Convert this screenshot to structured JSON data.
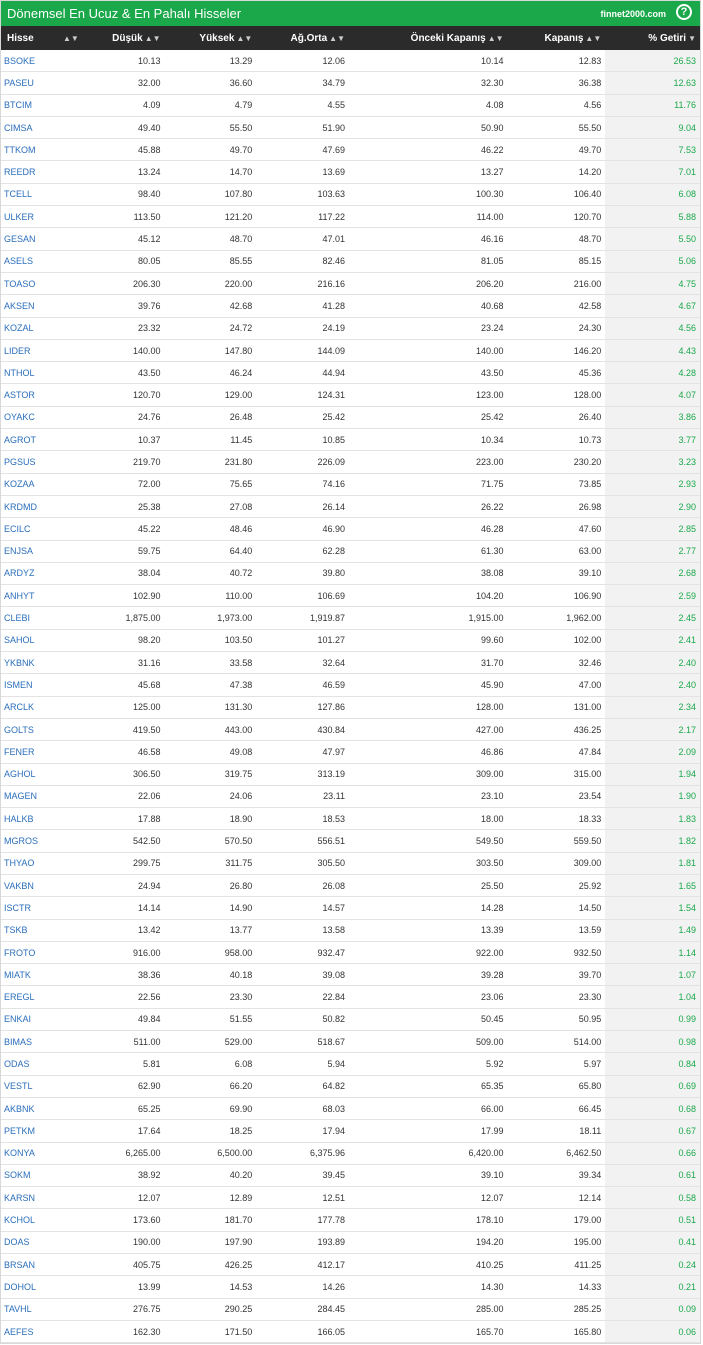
{
  "header": {
    "title": "Dönemsel En Ucuz & En Pahalı Hisseler",
    "brand": "finnet2000.com",
    "help": "?"
  },
  "columns": [
    "Hisse",
    "Düşük",
    "Yüksek",
    "Ağ.Orta",
    "Önceki Kapanış",
    "Kapanış",
    "% Getiri"
  ],
  "accent_color": "#1aa84a",
  "rows": [
    [
      "BSOKE",
      "10.13",
      "13.29",
      "12.06",
      "10.14",
      "12.83",
      "26.53"
    ],
    [
      "PASEU",
      "32.00",
      "36.60",
      "34.79",
      "32.30",
      "36.38",
      "12.63"
    ],
    [
      "BTCIM",
      "4.09",
      "4.79",
      "4.55",
      "4.08",
      "4.56",
      "11.76"
    ],
    [
      "CIMSA",
      "49.40",
      "55.50",
      "51.90",
      "50.90",
      "55.50",
      "9.04"
    ],
    [
      "TTKOM",
      "45.88",
      "49.70",
      "47.69",
      "46.22",
      "49.70",
      "7.53"
    ],
    [
      "REEDR",
      "13.24",
      "14.70",
      "13.69",
      "13.27",
      "14.20",
      "7.01"
    ],
    [
      "TCELL",
      "98.40",
      "107.80",
      "103.63",
      "100.30",
      "106.40",
      "6.08"
    ],
    [
      "ULKER",
      "113.50",
      "121.20",
      "117.22",
      "114.00",
      "120.70",
      "5.88"
    ],
    [
      "GESAN",
      "45.12",
      "48.70",
      "47.01",
      "46.16",
      "48.70",
      "5.50"
    ],
    [
      "ASELS",
      "80.05",
      "85.55",
      "82.46",
      "81.05",
      "85.15",
      "5.06"
    ],
    [
      "TOASO",
      "206.30",
      "220.00",
      "216.16",
      "206.20",
      "216.00",
      "4.75"
    ],
    [
      "AKSEN",
      "39.76",
      "42.68",
      "41.28",
      "40.68",
      "42.58",
      "4.67"
    ],
    [
      "KOZAL",
      "23.32",
      "24.72",
      "24.19",
      "23.24",
      "24.30",
      "4.56"
    ],
    [
      "LIDER",
      "140.00",
      "147.80",
      "144.09",
      "140.00",
      "146.20",
      "4.43"
    ],
    [
      "NTHOL",
      "43.50",
      "46.24",
      "44.94",
      "43.50",
      "45.36",
      "4.28"
    ],
    [
      "ASTOR",
      "120.70",
      "129.00",
      "124.31",
      "123.00",
      "128.00",
      "4.07"
    ],
    [
      "OYAKC",
      "24.76",
      "26.48",
      "25.42",
      "25.42",
      "26.40",
      "3.86"
    ],
    [
      "AGROT",
      "10.37",
      "11.45",
      "10.85",
      "10.34",
      "10.73",
      "3.77"
    ],
    [
      "PGSUS",
      "219.70",
      "231.80",
      "226.09",
      "223.00",
      "230.20",
      "3.23"
    ],
    [
      "KOZAA",
      "72.00",
      "75.65",
      "74.16",
      "71.75",
      "73.85",
      "2.93"
    ],
    [
      "KRDMD",
      "25.38",
      "27.08",
      "26.14",
      "26.22",
      "26.98",
      "2.90"
    ],
    [
      "ECILC",
      "45.22",
      "48.46",
      "46.90",
      "46.28",
      "47.60",
      "2.85"
    ],
    [
      "ENJSA",
      "59.75",
      "64.40",
      "62.28",
      "61.30",
      "63.00",
      "2.77"
    ],
    [
      "ARDYZ",
      "38.04",
      "40.72",
      "39.80",
      "38.08",
      "39.10",
      "2.68"
    ],
    [
      "ANHYT",
      "102.90",
      "110.00",
      "106.69",
      "104.20",
      "106.90",
      "2.59"
    ],
    [
      "CLEBI",
      "1,875.00",
      "1,973.00",
      "1,919.87",
      "1,915.00",
      "1,962.00",
      "2.45"
    ],
    [
      "SAHOL",
      "98.20",
      "103.50",
      "101.27",
      "99.60",
      "102.00",
      "2.41"
    ],
    [
      "YKBNK",
      "31.16",
      "33.58",
      "32.64",
      "31.70",
      "32.46",
      "2.40"
    ],
    [
      "ISMEN",
      "45.68",
      "47.38",
      "46.59",
      "45.90",
      "47.00",
      "2.40"
    ],
    [
      "ARCLK",
      "125.00",
      "131.30",
      "127.86",
      "128.00",
      "131.00",
      "2.34"
    ],
    [
      "GOLTS",
      "419.50",
      "443.00",
      "430.84",
      "427.00",
      "436.25",
      "2.17"
    ],
    [
      "FENER",
      "46.58",
      "49.08",
      "47.97",
      "46.86",
      "47.84",
      "2.09"
    ],
    [
      "AGHOL",
      "306.50",
      "319.75",
      "313.19",
      "309.00",
      "315.00",
      "1.94"
    ],
    [
      "MAGEN",
      "22.06",
      "24.06",
      "23.11",
      "23.10",
      "23.54",
      "1.90"
    ],
    [
      "HALKB",
      "17.88",
      "18.90",
      "18.53",
      "18.00",
      "18.33",
      "1.83"
    ],
    [
      "MGROS",
      "542.50",
      "570.50",
      "556.51",
      "549.50",
      "559.50",
      "1.82"
    ],
    [
      "THYAO",
      "299.75",
      "311.75",
      "305.50",
      "303.50",
      "309.00",
      "1.81"
    ],
    [
      "VAKBN",
      "24.94",
      "26.80",
      "26.08",
      "25.50",
      "25.92",
      "1.65"
    ],
    [
      "ISCTR",
      "14.14",
      "14.90",
      "14.57",
      "14.28",
      "14.50",
      "1.54"
    ],
    [
      "TSKB",
      "13.42",
      "13.77",
      "13.58",
      "13.39",
      "13.59",
      "1.49"
    ],
    [
      "FROTO",
      "916.00",
      "958.00",
      "932.47",
      "922.00",
      "932.50",
      "1.14"
    ],
    [
      "MIATK",
      "38.36",
      "40.18",
      "39.08",
      "39.28",
      "39.70",
      "1.07"
    ],
    [
      "EREGL",
      "22.56",
      "23.30",
      "22.84",
      "23.06",
      "23.30",
      "1.04"
    ],
    [
      "ENKAI",
      "49.84",
      "51.55",
      "50.82",
      "50.45",
      "50.95",
      "0.99"
    ],
    [
      "BIMAS",
      "511.00",
      "529.00",
      "518.67",
      "509.00",
      "514.00",
      "0.98"
    ],
    [
      "ODAS",
      "5.81",
      "6.08",
      "5.94",
      "5.92",
      "5.97",
      "0.84"
    ],
    [
      "VESTL",
      "62.90",
      "66.20",
      "64.82",
      "65.35",
      "65.80",
      "0.69"
    ],
    [
      "AKBNK",
      "65.25",
      "69.90",
      "68.03",
      "66.00",
      "66.45",
      "0.68"
    ],
    [
      "PETKM",
      "17.64",
      "18.25",
      "17.94",
      "17.99",
      "18.11",
      "0.67"
    ],
    [
      "KONYA",
      "6,265.00",
      "6,500.00",
      "6,375.96",
      "6,420.00",
      "6,462.50",
      "0.66"
    ],
    [
      "SOKM",
      "38.92",
      "40.20",
      "39.45",
      "39.10",
      "39.34",
      "0.61"
    ],
    [
      "KARSN",
      "12.07",
      "12.89",
      "12.51",
      "12.07",
      "12.14",
      "0.58"
    ],
    [
      "KCHOL",
      "173.60",
      "181.70",
      "177.78",
      "178.10",
      "179.00",
      "0.51"
    ],
    [
      "DOAS",
      "190.00",
      "197.90",
      "193.89",
      "194.20",
      "195.00",
      "0.41"
    ],
    [
      "BRSAN",
      "405.75",
      "426.25",
      "412.17",
      "410.25",
      "411.25",
      "0.24"
    ],
    [
      "DOHOL",
      "13.99",
      "14.53",
      "14.26",
      "14.30",
      "14.33",
      "0.21"
    ],
    [
      "TAVHL",
      "276.75",
      "290.25",
      "284.45",
      "285.00",
      "285.25",
      "0.09"
    ],
    [
      "AEFES",
      "162.30",
      "171.50",
      "166.05",
      "165.70",
      "165.80",
      "0.06"
    ]
  ]
}
